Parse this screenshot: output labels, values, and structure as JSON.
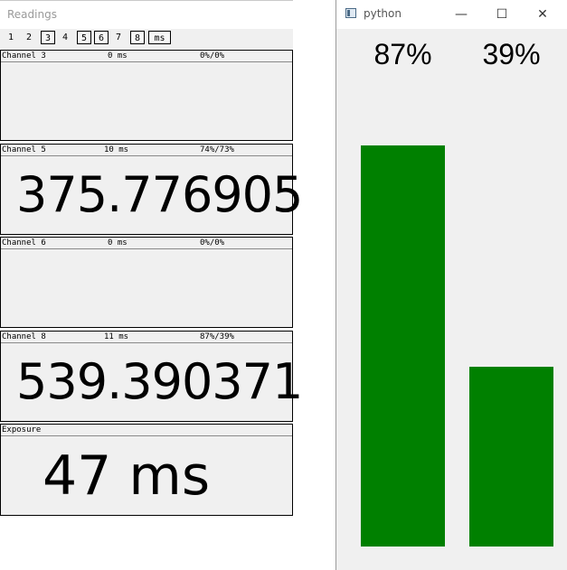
{
  "readings": {
    "title": "Readings",
    "toolbar": [
      {
        "label": "1",
        "active": false
      },
      {
        "label": "2",
        "active": false
      },
      {
        "label": "3",
        "active": true
      },
      {
        "label": "4",
        "active": false
      },
      {
        "label": "5",
        "active": true
      },
      {
        "label": "6",
        "active": true
      },
      {
        "label": "7",
        "active": false
      },
      {
        "label": "8",
        "active": true
      },
      {
        "label": "ms",
        "active": true
      }
    ],
    "panels": [
      {
        "name": "Channel 3",
        "time": "0 ms",
        "ratio": "0%/0%",
        "value": ""
      },
      {
        "name": "Channel 5",
        "time": "10 ms",
        "ratio": "74%/73%",
        "value": "375.776905"
      },
      {
        "name": "Channel 6",
        "time": "0 ms",
        "ratio": "0%/0%",
        "value": ""
      },
      {
        "name": "Channel 8",
        "time": "11 ms",
        "ratio": "87%/39%",
        "value": "539.390371"
      }
    ],
    "exposure": {
      "name": "Exposure",
      "value": "47 ms"
    }
  },
  "python": {
    "title": "python",
    "buttons": {
      "minimize": "—",
      "maximize": "☐",
      "close": "✕"
    },
    "bar_color": "#008000",
    "bars": [
      {
        "label": "87%",
        "level": 0.87
      },
      {
        "label": "39%",
        "level": 0.39
      }
    ]
  }
}
